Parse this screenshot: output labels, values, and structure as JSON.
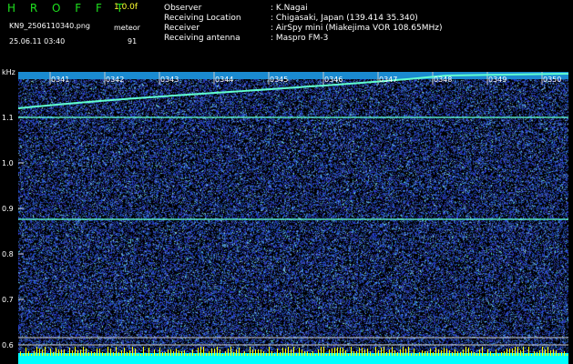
{
  "header": {
    "app_name": "H R O F F T",
    "version": "1.0.0f",
    "filename": "KN9_2506110340.png",
    "datetime": "25.06.11 03:40",
    "meteor_label": "meteor",
    "meteor_count": "91"
  },
  "metadata": [
    {
      "key": "Observer",
      "value": ": K.Nagai"
    },
    {
      "key": "Receiving Location",
      "value": ": Chigasaki, Japan (139.414 35.340)"
    },
    {
      "key": "Receiver",
      "value": ": AirSpy mini (Miakejima VOR 108.65MHz)"
    },
    {
      "key": "Receiving antenna",
      "value": ": Maspro FM-3"
    }
  ],
  "chart_data": {
    "type": "heatmap",
    "ylabel": "kHz",
    "y_ticks": [
      "1.1",
      "1.0",
      "0.9",
      "0.8",
      "0.7",
      "0.6"
    ],
    "x_ticks": [
      "0341",
      "0342",
      "0343",
      "0344",
      "0345",
      "0346",
      "0347",
      "0348",
      "0349",
      "0350"
    ],
    "colors": {
      "background": "#000000",
      "noise": "#2040c0",
      "signal": "#60ffd0",
      "grid": "#c8c8c8",
      "baseline": "#00ffff",
      "spikes": "#ffff00"
    }
  }
}
